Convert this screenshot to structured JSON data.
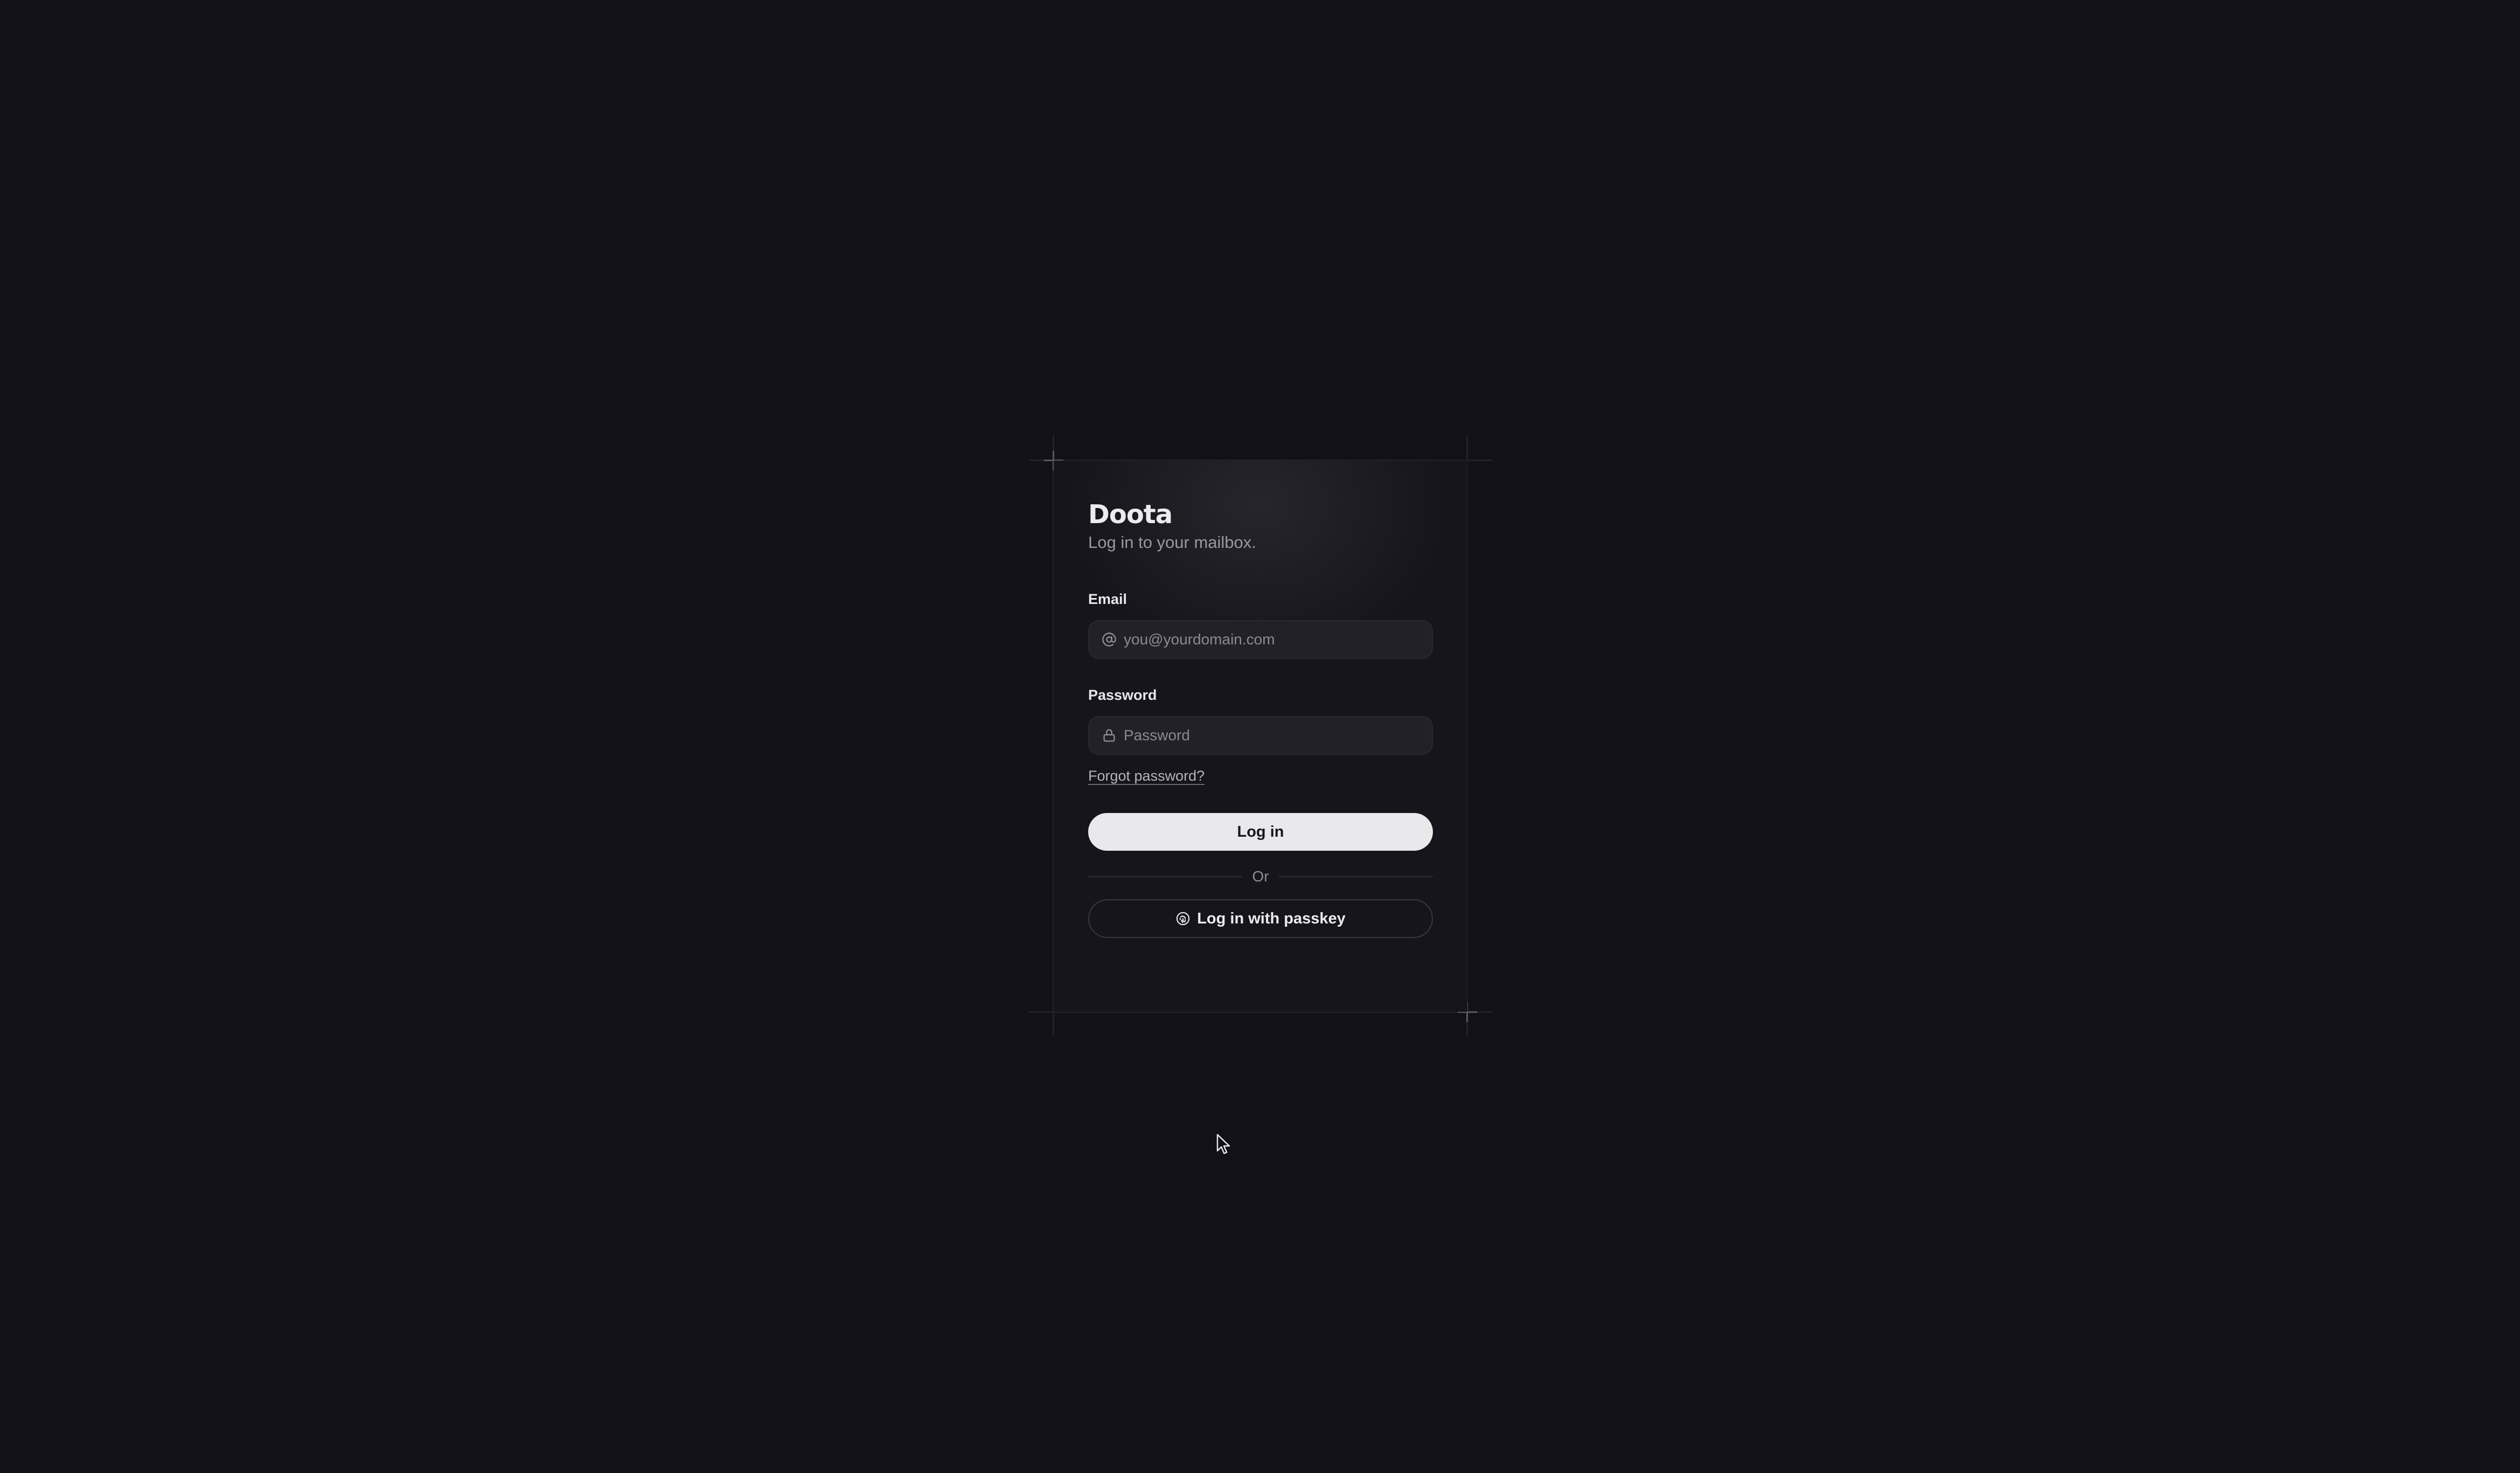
{
  "app": {
    "title": "Doota",
    "subtitle": "Log in to your mailbox."
  },
  "form": {
    "email": {
      "label": "Email",
      "placeholder": "you@yourdomain.com",
      "icon": "at-icon"
    },
    "password": {
      "label": "Password",
      "placeholder": "Password",
      "icon": "lock-icon"
    },
    "forgot_label": "Forgot password?",
    "submit_label": "Log in",
    "divider_label": "Or",
    "passkey": {
      "label": "Log in with passkey",
      "icon": "fingerprint-icon"
    }
  },
  "colors": {
    "background": "#121118",
    "card": "#16151b",
    "primary_button": "#e9e9ec",
    "input": "#222127"
  }
}
